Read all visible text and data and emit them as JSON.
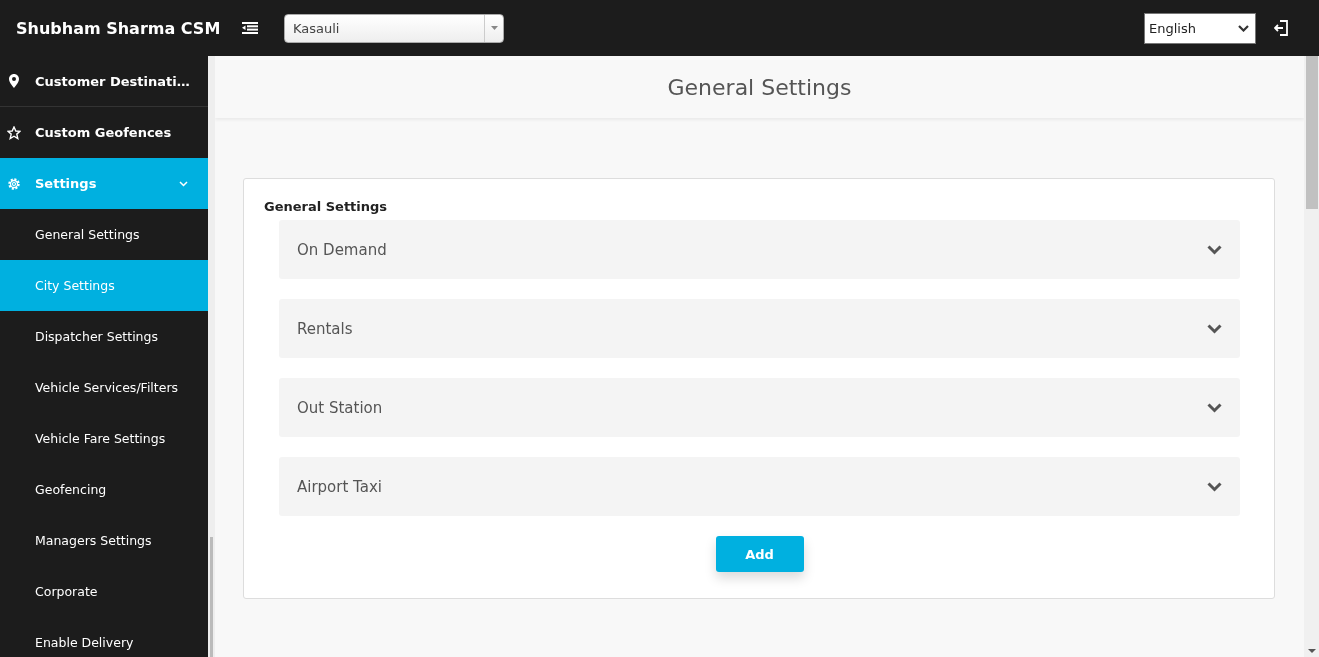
{
  "header": {
    "brand": "Shubham Sharma CSM",
    "city_select": {
      "value": "Kasauli"
    },
    "language_select": {
      "value": "English"
    }
  },
  "sidebar": {
    "items": [
      {
        "label": "Customer Destinati…",
        "selected": false
      },
      {
        "label": "Custom Geofences",
        "selected": false
      },
      {
        "label": "Settings",
        "selected": true,
        "expanded": true,
        "children": [
          {
            "label": "General Settings",
            "selected": false
          },
          {
            "label": "City Settings",
            "selected": true
          },
          {
            "label": "Dispatcher Settings",
            "selected": false
          },
          {
            "label": "Vehicle Services/Filters",
            "selected": false
          },
          {
            "label": "Vehicle Fare Settings",
            "selected": false
          },
          {
            "label": "Geofencing",
            "selected": false
          },
          {
            "label": "Managers Settings",
            "selected": false
          },
          {
            "label": "Corporate",
            "selected": false
          },
          {
            "label": "Enable Delivery",
            "selected": false
          }
        ]
      }
    ]
  },
  "page": {
    "title": "General Settings",
    "card": {
      "title": "General Settings",
      "panels": [
        {
          "label": "On Demand",
          "expanded": false
        },
        {
          "label": "Rentals",
          "expanded": false
        },
        {
          "label": "Out Station",
          "expanded": false
        },
        {
          "label": "Airport Taxi",
          "expanded": false
        }
      ],
      "button": "Add"
    }
  }
}
